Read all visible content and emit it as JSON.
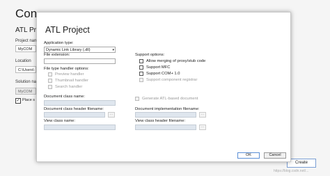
{
  "background": {
    "title": "Con",
    "subtitle": "ATL Pro",
    "project_name_label": "Project nam",
    "project_name_value": "MyCOM",
    "location_label": "Location",
    "location_value": "C:\\Users\\",
    "solution_name_label": "Solution nam",
    "solution_name_value": "MyCOM",
    "place_label": "Place s",
    "place_checked": true,
    "close_glyph": "✕",
    "create_label": "Create",
    "watermark": "https://blog.csdn.net/..."
  },
  "dialog": {
    "title": "ATL Project",
    "application_type_label": "Application type:",
    "application_type_value": "Dynamic Link Library (.dll)",
    "file_extension_label": "File extension:",
    "file_type_handler_label": "File type handler options:",
    "handler_options": [
      "Preview handler",
      "Thumbnail handler",
      "Search handler"
    ],
    "support_options_label": "Support options:",
    "support_options": [
      {
        "label": "Allow merging of proxy/stub code",
        "enabled": true
      },
      {
        "label": "Support MFC",
        "enabled": true
      },
      {
        "label": "Support COM+ 1.0",
        "enabled": true
      },
      {
        "label": "Support component registrar",
        "enabled": false
      }
    ],
    "document_class_name_label": "Document class name:",
    "generate_atl_label": "Generate ATL-based document",
    "doc_class_header_label": "Document class header filename:",
    "doc_impl_filename_label": "Document implementation filename:",
    "view_class_name_label": "View class name:",
    "view_class_header_label": "View class header filename:",
    "browse_label": "...",
    "ok_label": "OK",
    "cancel_label": "Cancel"
  },
  "colors": {
    "accent": "#5b8fd6",
    "disabled_field": "#dfe6ee"
  }
}
